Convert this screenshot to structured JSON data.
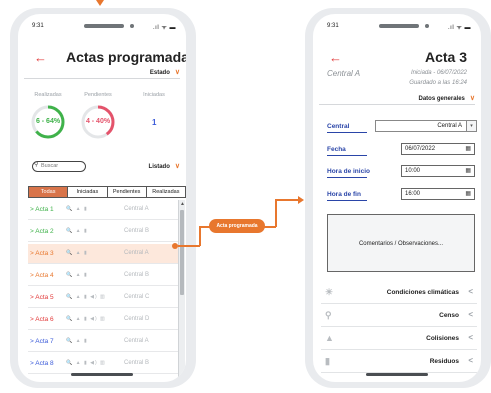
{
  "colors": {
    "accent_orange": "#e8772e",
    "back_red": "#e23a3a",
    "realizadas_green": "#3fb24a",
    "pendientes_red": "#e4536b",
    "link_blue": "#2a45a8",
    "selected_row_bg": "#fde8dc",
    "active_tab": "#d8744a"
  },
  "left_screen": {
    "status_time": "9:31",
    "status_icons": ".ıl ᯤ ▬",
    "title": "Actas programadas",
    "estado_label": "Estado",
    "stats_headers": [
      "Realizadas",
      "Pendientes",
      "Iniciadas"
    ],
    "realizadas": {
      "label": "6 - 64%",
      "fraction": 0.64
    },
    "pendientes": {
      "label": "4 - 40%",
      "fraction": 0.4
    },
    "iniciadas_count": "1",
    "search_placeholder": "Buscar",
    "listado_label": "Listado",
    "tabs": [
      "Todas",
      "Iniciadas",
      "Pendientes",
      "Realizadas"
    ],
    "active_tab": "Todas",
    "rows": [
      {
        "name": "> Acta 1",
        "color": "#3fb24a",
        "icons": "🔍 ▲ ▮",
        "central": "Central A"
      },
      {
        "name": "> Acta 2",
        "color": "#3fb24a",
        "icons": "🔍 ▲ ▮",
        "central": "Central B"
      },
      {
        "name": "> Acta 3",
        "color": "#e8772e",
        "icons": "🔍 ▲ ▮",
        "central": "Central A"
      },
      {
        "name": "> Acta 4",
        "color": "#e8772e",
        "icons": "🔍 ▲ ▮",
        "central": "Central B"
      },
      {
        "name": "> Acta 5",
        "color": "#e23a3a",
        "icons": "🔍 ▲ ▮ ◀) ▥",
        "central": "Central C"
      },
      {
        "name": "> Acta 6",
        "color": "#e23a3a",
        "icons": "🔍 ▲ ▮ ◀) ▥",
        "central": "Central D"
      },
      {
        "name": "> Acta 7",
        "color": "#3b5bd9",
        "icons": "🔍 ▲ ▮",
        "central": "Central A"
      },
      {
        "name": "> Acta 8",
        "color": "#3b5bd9",
        "icons": "🔍 ▲ ▮ ◀) ▥",
        "central": "Central B"
      }
    ],
    "selected_row_index": 2
  },
  "connector": {
    "label": "Acta programada"
  },
  "right_screen": {
    "status_time": "9:31",
    "status_icons": ".ıl ᯤ ▬",
    "title": "Acta 3",
    "central_label": "Central A",
    "iniciada": "Iniciada - 06/07/2022",
    "guardado": "Guardado a las 16:24",
    "datos_label": "Datos generales",
    "fields": {
      "central_label": "Central",
      "central_value": "Central A",
      "fecha_label": "Fecha",
      "fecha_value": "06/07/2022",
      "hora_inicio_label": "Hora de inicio",
      "hora_inicio_value": "10:00",
      "hora_fin_label": "Hora de fin",
      "hora_fin_value": "16:00"
    },
    "comments_placeholder": "Comentarios / Observaciones...",
    "sections": [
      "Condiciones climáticas",
      "Censo",
      "Colisiones",
      "Residuos"
    ]
  }
}
